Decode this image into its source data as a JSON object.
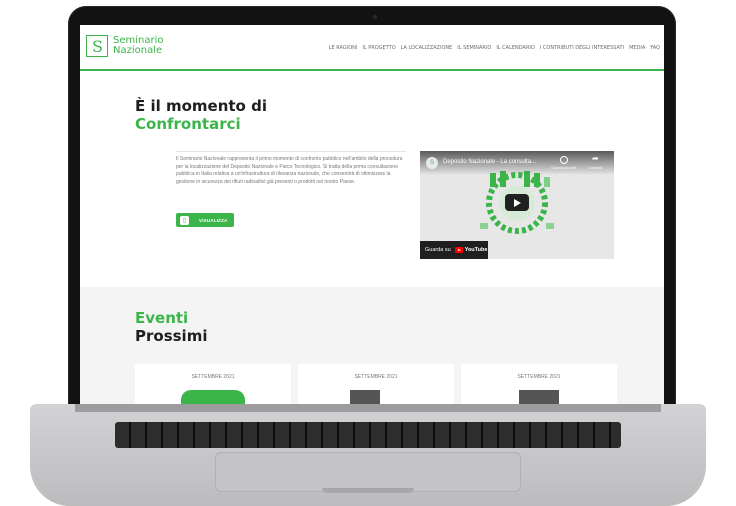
{
  "brand": {
    "logo_line1": "Seminario",
    "logo_line2": "Nazionale",
    "accent_color": "#3bb54a"
  },
  "nav": {
    "items": [
      "LE RAGIONI",
      "IL PROGETTO",
      "LA LOCALIZZAZIONE",
      "IL SEMINARIO",
      "IL CALENDARIO",
      "I CONTRIBUTI DEGLI INTERESSATI",
      "MEDIA",
      "FAQ"
    ]
  },
  "hero": {
    "title_line1": "È il momento di",
    "title_line2": "Confrontarci",
    "body": "Il Seminario Nazionale rappresenta il primo momento di confronto pubblico nell'ambito della procedura per la localizzazione del Deposito Nazionale e Parco Tecnologico. Si tratta della prima consultazione pubblica in Italia relativa a un'infrastruttura di rilevanza nazionale, che consentirà di ottimizzare la gestione in sicurezza dei rifiuti radioattivi già presenti o prodotti nel nostro Paese.",
    "cta_label": "VISUALIZZA"
  },
  "video": {
    "title": "Deposito Nazionale - La consulta...",
    "watch_later_label": "Guarda più tardi",
    "share_label": "Condividi",
    "watch_on_label": "Guarda su",
    "youtube_label": "YouTube"
  },
  "events": {
    "title_line1": "Eventi",
    "title_line2": "Prossimi",
    "cards": [
      {
        "month": "SETTEMBRE 2021",
        "color": "#3bb54a"
      },
      {
        "month": "SETTEMBRE 2021",
        "color": "#555555"
      },
      {
        "month": "SETTEMBRE 2021",
        "color": "#555555"
      }
    ]
  }
}
